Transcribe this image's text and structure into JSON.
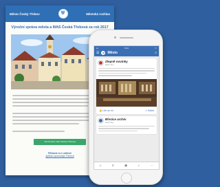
{
  "newsletter": {
    "header_left": "Město Český Třebov",
    "header_right": "Městská rozhlas",
    "title": "Výroční zpráva města a MAS Česká Třebová za rok 2017",
    "cta_label": "Otevřít plné znění Zprávy Třebová",
    "footer_line1": "Přihlaste se k odběru!",
    "footer_line2": "Aplikaci zpravodaje Třebová"
  },
  "phone": {
    "app_title": "Město",
    "status_time": "9:41",
    "card1": {
      "source": "Zlepně novinky",
      "date": "před 2 dny",
      "like": "Líbí se mi",
      "share": "Sdílet"
    },
    "card2": {
      "source": "Březice archiv",
      "date": "před 3 dny"
    }
  },
  "colors": {
    "background": "#2f5f9e",
    "brand_blue": "#2f6fb5",
    "cta_green": "#3aa66a"
  }
}
